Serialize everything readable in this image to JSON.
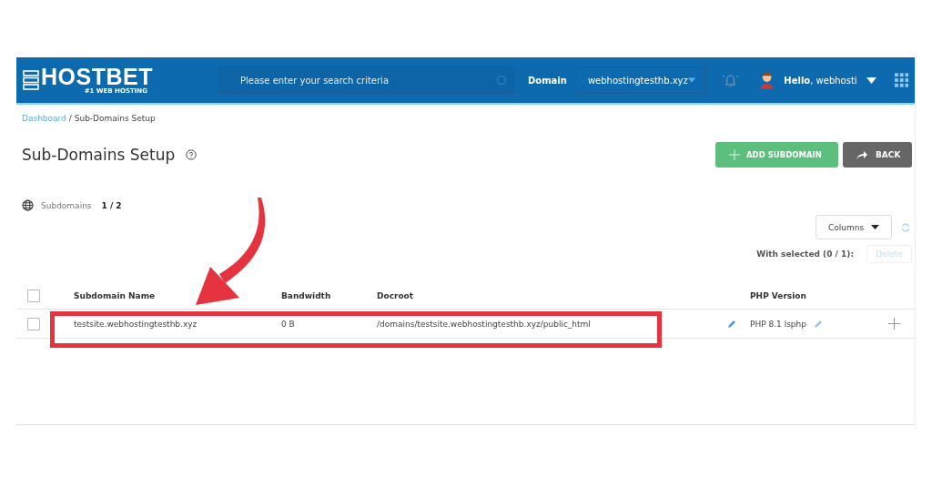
{
  "header": {
    "logo": "HOSTBET",
    "tagline": "#1 WEB HOSTING",
    "search": {
      "placeholder": "Please enter your search criteria"
    },
    "domain_label": "Domain",
    "domain_value": "webhostingtesthb.xyz",
    "greeting": "**Hello**, webhosti"
  },
  "breadcrumb": [
    {
      "label": "Dashboard",
      "kind": "link"
    },
    {
      "label": "/ Sub-Domains Setup",
      "kind": "current"
    }
  ],
  "page_title": "Sub-Domains Setup",
  "buttons": [
    {
      "label": "ADD SUBDOMAIN",
      "kind": "add"
    },
    {
      "label": "BACK",
      "kind": "back"
    }
  ],
  "counter": {
    "label": "Subdomains",
    "value": "1 / 2"
  },
  "columns_button": "Columns",
  "bulk": {
    "label": "With selected (0 / 1):",
    "action": "Delete",
    "disabled": true
  },
  "table": {
    "header_checked": false,
    "columns": [
      "Subdomain Name",
      "Bandwidth",
      "Docroot",
      "PHP Version"
    ],
    "rows": [
      {
        "checked": false,
        "name": "testsite.webhostingtesthb.xyz",
        "bandwidth": "0 B",
        "docroot": "/domains/testsite.webhostingtesthb.xyz/public_html",
        "php": "PHP 8.1 lsphp"
      }
    ]
  }
}
